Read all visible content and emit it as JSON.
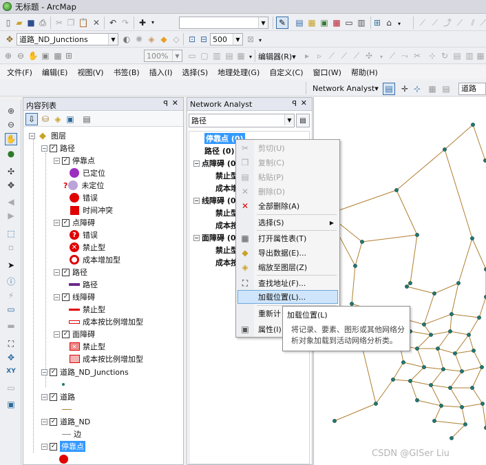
{
  "window": {
    "title": "无标题 - ArcMap"
  },
  "toolbar1": {
    "scale_value": ""
  },
  "toolbar2": {
    "layer_combo": "道路_ND_Junctions",
    "size_value": "500"
  },
  "toolbar3": {
    "zoom_value": "100%",
    "editor_label": "编辑器(R)▾"
  },
  "menu": {
    "items": [
      "文件(F)",
      "编辑(E)",
      "视图(V)",
      "书签(B)",
      "插入(I)",
      "选择(S)",
      "地理处理(G)",
      "自定义(C)",
      "窗口(W)",
      "帮助(H)"
    ]
  },
  "na_toolbar": {
    "label": "Network Analyst▾",
    "tab_label": "道路_N"
  },
  "toc": {
    "title": "内容列表",
    "root": "图层",
    "route_layer": "路径",
    "stops": {
      "label": "停靠点",
      "items": [
        "已定位",
        "未定位",
        "错误",
        "时间冲突"
      ]
    },
    "point_barriers": {
      "label": "点障碍",
      "items": [
        "错误",
        "禁止型",
        "成本增加型"
      ]
    },
    "routes": {
      "label": "路径",
      "items": [
        "路径"
      ]
    },
    "line_barriers": {
      "label": "线障碍",
      "items": [
        "禁止型",
        "成本按比例增加型"
      ]
    },
    "polygon_barriers": {
      "label": "面障碍",
      "items": [
        "禁止型",
        "成本按比例增加型"
      ]
    },
    "layers": [
      "道路_ND_Junctions",
      "道路",
      "道路_ND",
      "停靠点"
    ],
    "edge_label": "边"
  },
  "na_window": {
    "title": "Network Analyst",
    "combo_value": "路径",
    "tree": [
      {
        "label": "停靠点 (0)",
        "selected": true
      },
      {
        "label": "路径 (0)"
      },
      {
        "label": "点障碍 (0"
      },
      {
        "label": "禁止型"
      },
      {
        "label": "成本增"
      },
      {
        "label": "线障碍 (0"
      },
      {
        "label": "禁止型"
      },
      {
        "label": "成本按"
      },
      {
        "label": "面障碍 (0"
      },
      {
        "label": "禁止型"
      },
      {
        "label": "成本按"
      }
    ]
  },
  "context_menu": {
    "items": [
      {
        "label": "剪切(U)",
        "icon": "scissors-icon",
        "disabled": true
      },
      {
        "label": "复制(C)",
        "icon": "copy-icon",
        "disabled": true
      },
      {
        "label": "粘贴(P)",
        "icon": "paste-icon",
        "disabled": true
      },
      {
        "label": "删除(D)",
        "icon": "delete-icon",
        "disabled": true
      },
      {
        "label": "全部删除(A)",
        "icon": "delete-all-icon",
        "disabled": false
      },
      {
        "label": "选择(S)",
        "icon": "",
        "disabled": false,
        "submenu": true
      },
      {
        "label": "打开属性表(T)",
        "icon": "table-icon",
        "disabled": false
      },
      {
        "label": "导出数据(E)...",
        "icon": "export-icon",
        "disabled": false
      },
      {
        "label": "缩放至图层(Z)",
        "icon": "zoom-layer-icon",
        "disabled": false
      },
      {
        "label": "查找地址(F)...",
        "icon": "binoculars-icon",
        "disabled": false
      },
      {
        "label": "加载位置(L)...",
        "icon": "",
        "disabled": false,
        "highlighted": true
      },
      {
        "label": "重新计",
        "icon": "",
        "disabled": false
      },
      {
        "label": "属性(I)...",
        "icon": "properties-icon",
        "disabled": false
      }
    ]
  },
  "tooltip": {
    "title": "加载位置(L)",
    "line1": "将记录、要素、图形或其他网络分",
    "line2": "析对象加载到活动网络分析类。"
  },
  "watermark": "CSDN @GISer Liu",
  "colors": {
    "network_line": "#b07d2e",
    "junction_fill": "#1f7a72",
    "stop_red": "#e00000",
    "selection_blue": "#3399ff"
  }
}
